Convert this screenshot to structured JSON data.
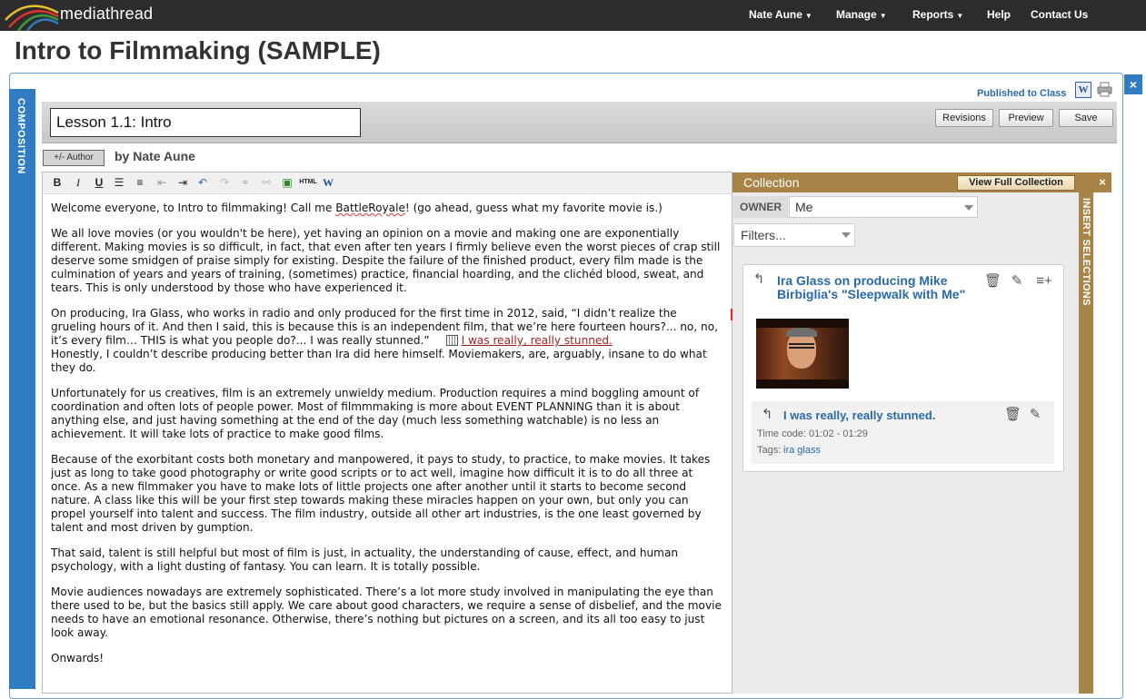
{
  "app": {
    "name": "mediathread"
  },
  "nav": [
    {
      "label": "Nate Aune",
      "dropdown": true
    },
    {
      "label": "Manage",
      "dropdown": true
    },
    {
      "label": "Reports",
      "dropdown": true
    },
    {
      "label": "Help",
      "dropdown": false
    },
    {
      "label": "Contact Us",
      "dropdown": false
    }
  ],
  "page": {
    "title": "Intro to Filmmaking (SAMPLE)"
  },
  "composition": {
    "tab_label": "COMPOSITION",
    "published_label": "Published to Class",
    "title_value": "Lesson 1.1: Intro",
    "buttons": {
      "revisions": "Revisions",
      "preview": "Preview",
      "save": "Save"
    },
    "author_button": "+/- Author",
    "byline": "by Nate Aune",
    "toolbar_icons": [
      "bold-icon",
      "italic-icon",
      "underline-icon",
      "bullet-list-icon",
      "numbered-list-icon",
      "outdent-icon",
      "indent-icon",
      "undo-icon",
      "redo-icon",
      "link-icon",
      "unlink-icon",
      "image-icon",
      "html-icon",
      "word-paste-icon"
    ],
    "paragraphs": {
      "p1a": "Welcome everyone, to Intro to filmmaking! Call me ",
      "p1_spell": "BattleRoyale",
      "p1b": "! (go ahead, guess what my favorite movie is.)",
      "p2": "We all love movies (or you wouldn't be here), yet having an opinion on a movie and making one are exponentially different. Making movies is so difficult, in fact, that even after ten years I firmly believe even the worst pieces of crap still deserve some smidgen of praise simply for existing. Despite the failure of the finished product, every film made is the culmination of years and years of training, (sometimes) practice, financial hoarding, and the clichéd blood, sweat, and tears. This is only understood by those who have experienced it.",
      "p3a": "On producing, Ira Glass, who works in radio and only produced for the first time in 2012, said, “I didn’t realize the grueling hours of it. And then I said, this is because this is an independent film, that we’re here fourteen hours?... no, no, it’s every film… THIS is what you people do?... I was really stunned.”",
      "p3_citation": "I was really, really stunned.",
      "p3b": "Honestly, I couldn’t describe producing better than Ira did here himself. Moviemakers, are, arguably, insane to do what they do.",
      "p4": "Unfortunately for us creatives, film is an extremely unwieldy medium. Production requires a mind boggling amount of coordination and often lots of people power. Most of filmmmaking is more about EVENT PLANNING than it is about anything else, and just having something at the end of the day (much less something watchable) is no less an achievement. It will take lots of practice to make good films.",
      "p5": "Because of the exorbitant costs both monetary and manpowered, it pays to study, to practice, to make movies. It takes just as long to take good photography or write good scripts or to act well, imagine how difficult it is to do all three at once. As a new filmmaker you have to make lots of little projects one after another until it starts to become second nature. A class like this will be your first step towards making these miracles happen on your own, but only you can propel yourself into talent and success. The film industry, outside all other art industries, is the one least governed by talent and most driven by gumption.",
      "p6": "That said, talent is still helpful but most of film is just, in actuality, the understanding of cause, effect, and human psychology, with a light dusting of fantasy. You can learn. It is totally possible.",
      "p7": "Movie audiences nowadays are extremely sophisticated. There’s a lot more study involved in manipulating the eye than there used to be, but the basics still apply. We care about good characters, we require a sense of disbelief, and the movie needs to have an emotional resonance. Otherwise, there’s nothing but pictures on a screen, and its all too easy to just look away.",
      "p8": "Onwards!"
    }
  },
  "collection": {
    "title": "Collection",
    "view_full_button": "View Full Collection",
    "close_label": "×",
    "insert_selections_label": "INSERT SELECTIONS",
    "owner_label": "OWNER",
    "owner_value": "Me",
    "filters_placeholder": "Filters...",
    "item": {
      "title": "Ira Glass on producing Mike Birbiglia's \"Sleepwalk with Me\"",
      "selection": {
        "title": "I was really, really stunned.",
        "timecode": "Time code: 01:02 - 01:29",
        "tags_label": "Tags:",
        "tag": "ira glass"
      }
    }
  },
  "colors": {
    "topbar": "#2c2c2c",
    "accent_blue": "#2f7cc3",
    "collection_brown": "#a88449",
    "link_blue": "#2a6aa8"
  }
}
